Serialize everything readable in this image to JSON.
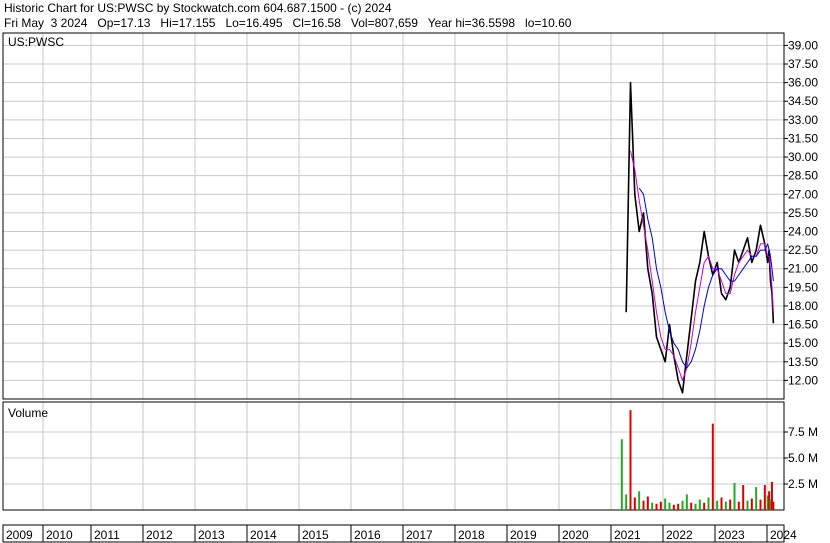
{
  "header": {
    "title": "Historic Chart for US:PWSC by Stockwatch.com 604.687.1500 - (c) 2024",
    "quote": "Fri May  3 2024   Op=17.13   Hi=17.155   Lo=16.495   Cl=16.58   Vol=807,659   Year hi=36.5598   lo=10.60"
  },
  "colors": {
    "price": "#000000",
    "ma_short": "#cc00cc",
    "ma_long": "#0000cc",
    "vol_up": "#22aa22",
    "vol_down": "#dd0000",
    "grid": "#c8c8c8"
  },
  "chart_data": [
    {
      "type": "line",
      "panel": "price",
      "label": "US:PWSC",
      "ylim": [
        10.5,
        40.0
      ],
      "yticks": [
        "39.00",
        "37.50",
        "36.00",
        "34.50",
        "33.00",
        "31.50",
        "30.00",
        "28.50",
        "27.00",
        "25.50",
        "24.00",
        "22.50",
        "21.00",
        "19.50",
        "18.00",
        "16.50",
        "15.00",
        "13.50",
        "12.00"
      ],
      "x": [
        "2021-04",
        "2021-05",
        "2021-06",
        "2021-07",
        "2021-08",
        "2021-09",
        "2021-10",
        "2021-11",
        "2021-12",
        "2022-01",
        "2022-02",
        "2022-03",
        "2022-04",
        "2022-05",
        "2022-06",
        "2022-07",
        "2022-08",
        "2022-09",
        "2022-10",
        "2022-11",
        "2022-12",
        "2023-01",
        "2023-02",
        "2023-03",
        "2023-04",
        "2023-05",
        "2023-06",
        "2023-07",
        "2023-08",
        "2023-09",
        "2023-10",
        "2023-11",
        "2023-12",
        "2024-01",
        "2024-02",
        "2024-03",
        "2024-04",
        "2024-05"
      ],
      "series": [
        {
          "name": "close",
          "values": [
            17.5,
            36.0,
            27.0,
            24.0,
            25.5,
            21.0,
            19.0,
            15.5,
            14.5,
            13.5,
            16.5,
            14.0,
            12.0,
            11.0,
            14.0,
            17.0,
            20.0,
            21.5,
            24.0,
            22.0,
            20.5,
            21.5,
            19.0,
            18.5,
            19.5,
            22.5,
            21.5,
            22.5,
            23.5,
            21.5,
            22.5,
            24.5,
            23.0,
            21.5,
            22.5,
            20.0,
            19.0,
            16.6
          ]
        },
        {
          "name": "",
          "values": [
            null,
            30.5,
            29.0,
            26.5,
            24.5,
            22.5,
            20.0,
            17.5,
            15.5,
            14.5,
            14.5,
            14.0,
            13.0,
            12.0,
            13.0,
            15.0,
            17.5,
            19.5,
            21.5,
            22.0,
            21.0,
            21.0,
            20.0,
            19.0,
            19.0,
            20.5,
            21.5,
            22.0,
            22.5,
            22.0,
            22.0,
            23.0,
            23.0,
            22.0,
            22.0,
            21.0,
            19.5,
            17.5
          ]
        },
        {
          "name": "",
          "values": [
            null,
            null,
            null,
            27.5,
            27.0,
            25.0,
            23.5,
            21.0,
            19.5,
            17.5,
            16.0,
            15.0,
            14.5,
            13.5,
            13.0,
            13.5,
            14.5,
            16.0,
            18.0,
            19.5,
            20.5,
            21.0,
            21.0,
            20.5,
            20.0,
            20.0,
            20.5,
            21.0,
            21.5,
            22.0,
            22.0,
            22.5,
            22.5,
            23.0,
            22.5,
            22.0,
            21.0,
            20.0
          ]
        }
      ]
    },
    {
      "type": "bar",
      "panel": "volume",
      "label": "Volume",
      "ylim": [
        0,
        10000000
      ],
      "yticks": [
        "7.5 M",
        "5.0 M",
        "2.5 M"
      ],
      "x": [
        "2021-03",
        "2021-04",
        "2021-05",
        "2021-06",
        "2021-07",
        "2021-08",
        "2021-09",
        "2021-10",
        "2021-11",
        "2021-12",
        "2022-01",
        "2022-02",
        "2022-03",
        "2022-04",
        "2022-05",
        "2022-06",
        "2022-07",
        "2022-08",
        "2022-09",
        "2022-10",
        "2022-11",
        "2022-12",
        "2023-01",
        "2023-02",
        "2023-03",
        "2023-04",
        "2023-05",
        "2023-06",
        "2023-07",
        "2023-08",
        "2023-09",
        "2023-10",
        "2023-11",
        "2023-12",
        "2024-01",
        "2024-02",
        "2024-03",
        "2024-04",
        "2024-05"
      ],
      "values": [
        6800000,
        1500000,
        9600000,
        1200000,
        1800000,
        900000,
        1300000,
        700000,
        600000,
        800000,
        1100000,
        700000,
        500000,
        600000,
        900000,
        1500000,
        700000,
        600000,
        1000000,
        700000,
        1200000,
        8300000,
        900000,
        1200000,
        800000,
        1000000,
        2600000,
        800000,
        2400000,
        900000,
        1100000,
        2200000,
        1000000,
        2400000,
        1400000,
        1800000,
        1000000,
        2700000,
        800000
      ],
      "direction": [
        "up",
        "up",
        "down",
        "down",
        "up",
        "down",
        "down",
        "up",
        "down",
        "down",
        "up",
        "up",
        "down",
        "down",
        "up",
        "up",
        "down",
        "up",
        "up",
        "down",
        "up",
        "down",
        "up",
        "down",
        "up",
        "down",
        "up",
        "down",
        "down",
        "up",
        "down",
        "up",
        "down",
        "down",
        "up",
        "down",
        "up",
        "down",
        "down"
      ]
    },
    {
      "type": "axis",
      "panel": "time",
      "categories": [
        "2009",
        "2010",
        "2011",
        "2012",
        "2013",
        "2014",
        "2015",
        "2016",
        "2017",
        "2018",
        "2019",
        "2020",
        "2021",
        "2022",
        "2023",
        "2024"
      ]
    }
  ]
}
